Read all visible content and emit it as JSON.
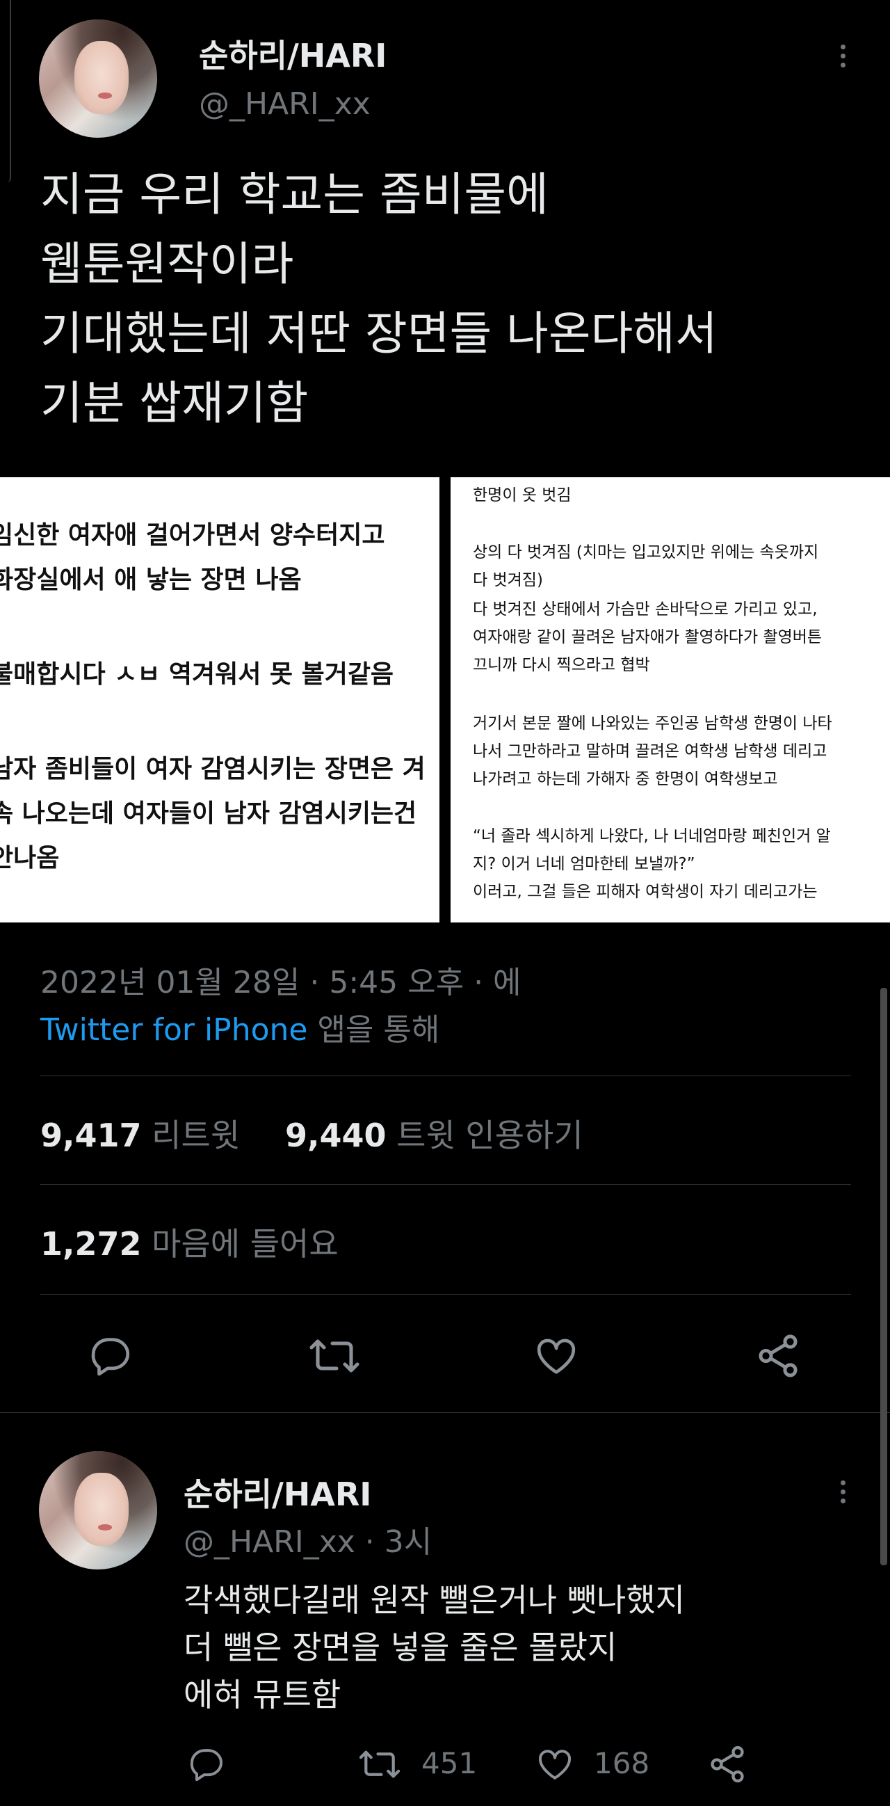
{
  "main_tweet": {
    "author_name": "순하리/HARI",
    "author_handle": "@_HARI_xx",
    "text_lines": [
      "지금 우리 학교는 좀비물에",
      "웹툰원작이라",
      "기대했는데 저딴 장면들 나온다해서",
      "기분 쌉재기함"
    ],
    "image_left_lines": [
      "임신한 여자애 걸어가면서 양수터지고",
      "화장실에서 애 낳는 장면 나옴",
      "",
      "불매합시다 ㅅㅂ 역겨워서 못 볼거같음",
      "",
      "남자 좀비들이 여자 감염시키는 장면은 겨",
      "속 나오는데 여자들이 남자 감염시키는건",
      "안나옴"
    ],
    "image_right_lines": [
      "한명이 옷 벗김",
      "",
      "상의 다 벗겨짐 (치마는 입고있지만 위에는 속옷까지",
      "다 벗겨짐)",
      "다 벗겨진 상태에서 가슴만 손바닥으로 가리고 있고,",
      "여자애랑 같이 끌려온 남자애가 촬영하다가 촬영버튼",
      "끄니까 다시 찍으라고 협박",
      "",
      "거기서 본문 짤에 나와있는 주인공 남학생 한명이 나타",
      "나서 그만하라고 말하며 끌려온 여학생 남학생 데리고",
      "나가려고 하는데 가해자 중 한명이 여학생보고",
      "",
      "“너 졸라 섹시하게 나왔다, 나 너네엄마랑 페친인거 알",
      "지? 이거 너네 엄마한테 보낼까?”",
      "이러고, 그걸 들은 피해자 여학생이 자기 데리고가는"
    ],
    "timestamp": "2022년 01월 28일 · 5:45 오후 · 에",
    "source_app": "Twitter for iPhone",
    "source_suffix": " 앱을 통해",
    "retweets_count": "9,417",
    "retweets_label": "리트윗",
    "quotes_count": "9,440",
    "quotes_label": "트윗 인용하기",
    "likes_count": "1,272",
    "likes_label": "마음에 들어요"
  },
  "reply_tweet": {
    "author_name": "순하리/HARI",
    "handle_time": "@_HARI_xx · 3시",
    "text_lines": [
      "각색했다길래 원작 뺄은거나 뺏나했지",
      "더 뺄은 장면을 넣을 줄은 몰랐지",
      "에혀 뮤트함"
    ],
    "retweet_count": "451",
    "like_count": "168"
  },
  "icons": {
    "reply": "reply-icon",
    "retweet": "retweet-icon",
    "like": "heart-icon",
    "share": "share-icon",
    "more": "more-options-icon"
  },
  "colors": {
    "background": "#000000",
    "text": "#e7e9ea",
    "muted": "#71767b",
    "link": "#1d9bf0",
    "divider": "#2f3336"
  }
}
